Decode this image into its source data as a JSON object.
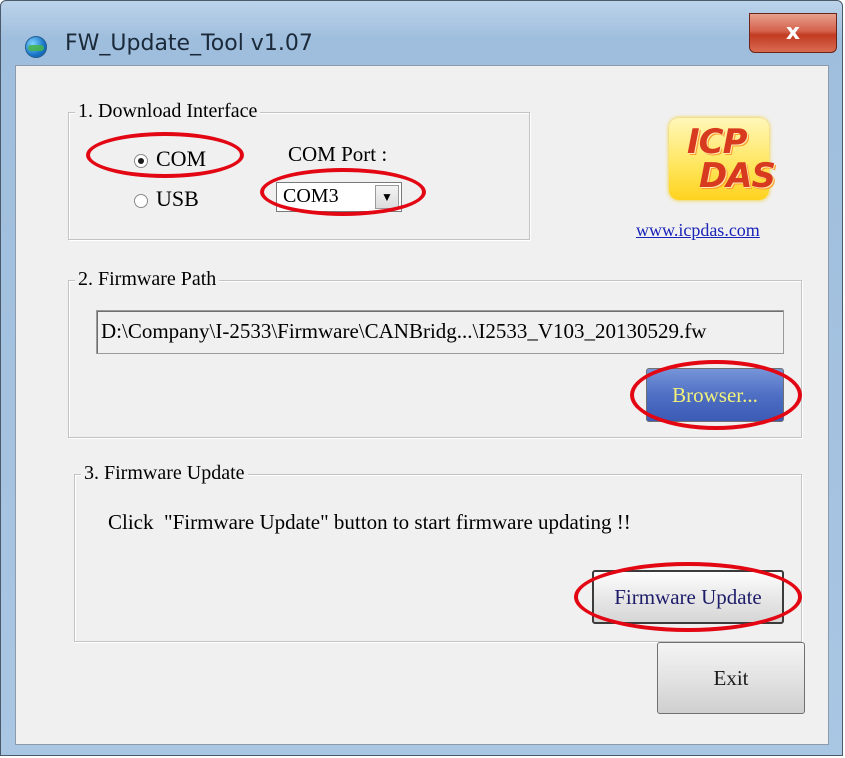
{
  "window": {
    "title": "FW_Update_Tool v1.07",
    "close_glyph": "x",
    "icon": "app-globe-icon"
  },
  "download_interface": {
    "legend": "1. Download Interface",
    "com_label": "COM",
    "usb_label": "USB",
    "selected": "COM",
    "com_port_label": "COM Port :",
    "com_port_value": "COM3"
  },
  "brand": {
    "logo_line1": "ICP",
    "logo_line2": "DAS",
    "link_text": "www.icpdas.com"
  },
  "firmware_path": {
    "legend": "2. Firmware Path",
    "path_value": "D:\\Company\\I-2533\\Firmware\\CANBridg...\\I2533_V103_20130529.fw",
    "browse_label": "Browser..."
  },
  "firmware_update": {
    "legend": "3. Firmware Update",
    "instruction": "Click  \"Firmware Update\" button to start firmware updating !!",
    "update_label": "Firmware Update"
  },
  "footer": {
    "exit_label": "Exit"
  },
  "colors": {
    "highlight_ellipse": "#e30613",
    "browser_button_bg": "#4f6fc4",
    "browser_button_text": "#f2f27a",
    "link": "#1a23b8"
  }
}
